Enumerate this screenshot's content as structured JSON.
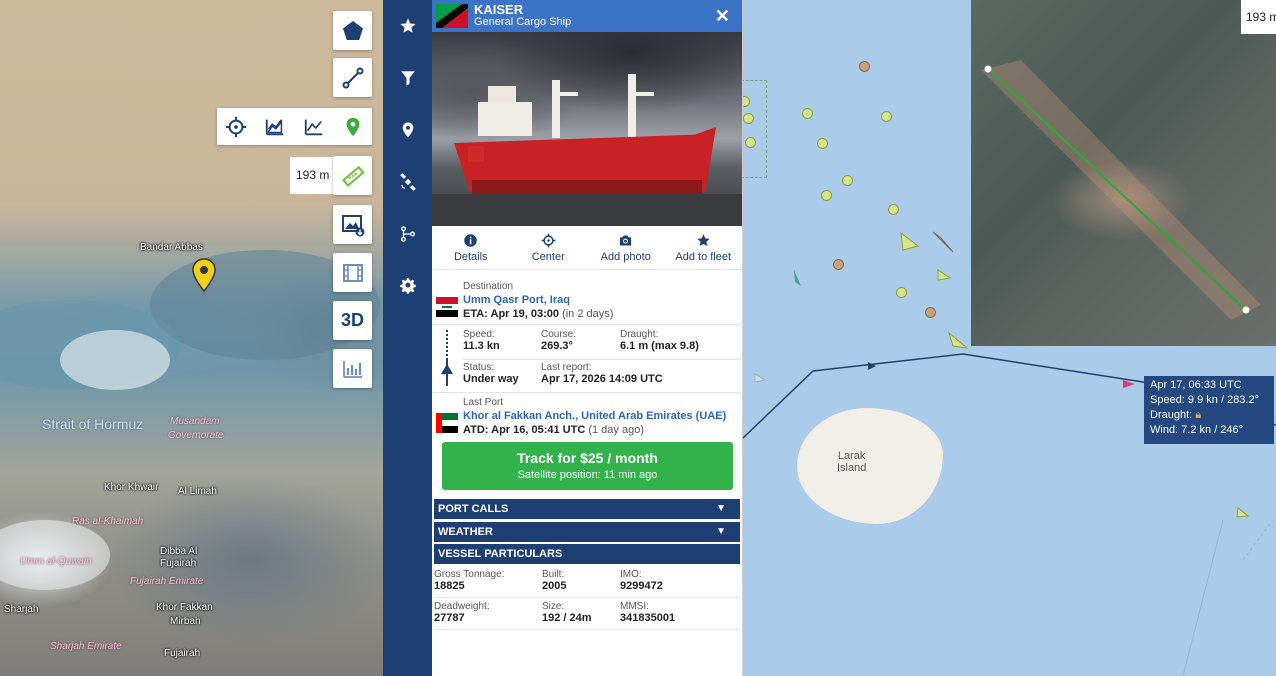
{
  "left_map": {
    "labels": {
      "bandar_abbas": "Bandar Abbas",
      "strait": "Strait of Hormuz",
      "musandam": "Musandam",
      "governorate": "Governorate",
      "khor_khwair": "Khor Khwair",
      "al_limah": "Al Limah",
      "ras_al_khaimah": "Ras al-Khaimah",
      "umm_al_quwain": "Umm al-Quwain",
      "dibba": "Dibba Al",
      "fujairah": "Fujairah",
      "fujairah_emirate": "Fujairah Emirate",
      "sharjah": "Sharjah",
      "khor_fakkan": "Khor Fakkan",
      "mirbah": "Mirbah",
      "sharjah_emirate": "Sharjah Emirate",
      "fujairah2": "Fujairah"
    },
    "distance": "193 m",
    "tools": [
      "pentagon-icon",
      "line-measure-icon",
      "ruler-icon",
      "image-download-icon",
      "film-icon",
      "3D",
      "bar-chart-icon"
    ],
    "chart_tools": [
      "crosshair-icon",
      "area-chart-icon",
      "line-chart-icon",
      "location-pin-icon"
    ]
  },
  "sidebar": [
    "star-icon",
    "filter-icon",
    "map-pin-icon",
    "satellite-icon",
    "route-icon",
    "gear-icon"
  ],
  "vessel": {
    "name": "KAISER",
    "type": "General Cargo Ship",
    "actions": {
      "details": "Details",
      "center": "Center",
      "add_photo": "Add photo",
      "add_fleet": "Add to fleet"
    },
    "destination_label": "Destination",
    "destination": "Umm Qasr Port, Iraq",
    "eta_label": "ETA:",
    "eta": "Apr 19, 03:00",
    "eta_rel": "(in 2 days)",
    "speed_label": "Speed:",
    "speed": "11.3 kn",
    "course_label": "Course:",
    "course": "269.3°",
    "draught_label": "Draught:",
    "draught": "6.1 m (max 9.8)",
    "status_label": "Status:",
    "status": "Under way",
    "last_report_label": "Last report:",
    "last_report": "Apr 17, 2026 14:09 UTC",
    "last_port_label": "Last Port",
    "last_port": "Khor al Fakkan Anch., United Arab Emirates (UAE)",
    "atd_label": "ATD:",
    "atd": "Apr 16, 05:41 UTC",
    "atd_rel": "(1 day ago)",
    "track": {
      "title": "Track for $25 / month",
      "subtitle": "Satellite position: 11 min ago"
    },
    "sections": {
      "port_calls": "PORT CALLS",
      "weather": "WEATHER",
      "particulars": "VESSEL PARTICULARS"
    },
    "particulars": {
      "gross_tonnage_label": "Gross Tonnage:",
      "gross_tonnage": "18825",
      "built_label": "Built:",
      "built": "2005",
      "imo_label": "IMO:",
      "imo": "9299472",
      "deadweight_label": "Deadweight:",
      "deadweight": "27787",
      "size_label": "Size:",
      "size": "192 / 24m",
      "mmsi_label": "MMSI:",
      "mmsi": "341835001"
    }
  },
  "right_map": {
    "island_name_1": "Larak",
    "island_name_2": "Island",
    "distance": "193 m",
    "tooltip": {
      "time": "Apr 17, 06:33 UTC",
      "speed": "Speed: 9.9 kn / 283.2°",
      "draught": "Draught:",
      "wind": "Wind: 7.2 kn / 246°"
    }
  },
  "colors": {
    "brand": "#1e3f74",
    "header": "#3b73c7",
    "track": "#31b24a",
    "link": "#2b65b8"
  }
}
